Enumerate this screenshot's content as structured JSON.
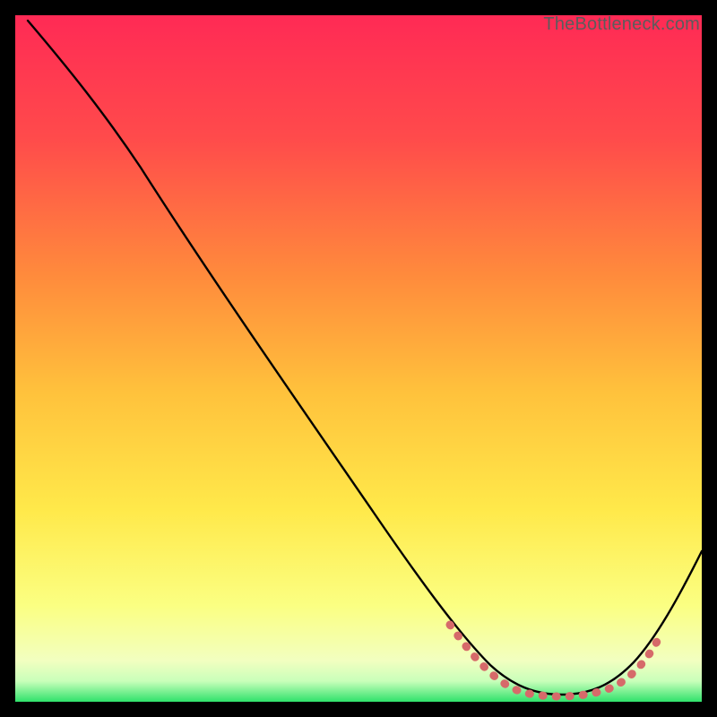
{
  "watermark": "TheBottleneck.com",
  "chart_data": {
    "type": "line",
    "title": "",
    "xlabel": "",
    "ylabel": "",
    "xlim": [
      0,
      100
    ],
    "ylim": [
      0,
      100
    ],
    "grid": false,
    "curve_note": "Black curve approximated from pixels; coral segment highlights the low, flat 'good' region near the bottom-right.",
    "series": [
      {
        "name": "bottleneck-curve",
        "color": "#000000",
        "x": [
          2,
          10,
          20,
          30,
          40,
          50,
          60,
          66,
          70,
          74,
          78,
          82,
          86,
          90,
          93,
          100
        ],
        "y": [
          99,
          88,
          74,
          60,
          46,
          32,
          18,
          10,
          5,
          2,
          1,
          1,
          2,
          5,
          10,
          22
        ]
      },
      {
        "name": "good-region-highlight",
        "color": "#d85a5a",
        "x": [
          66,
          70,
          74,
          78,
          82,
          86,
          90,
          93
        ],
        "y": [
          10,
          5,
          2,
          1,
          1,
          2,
          5,
          10
        ]
      }
    ],
    "background_gradient": {
      "top": "#ff2a55",
      "mid1": "#ff7a3c",
      "mid2": "#ffd23c",
      "mid3": "#fff96a",
      "low": "#fcffb8",
      "bottom": "#2fe26b"
    }
  }
}
